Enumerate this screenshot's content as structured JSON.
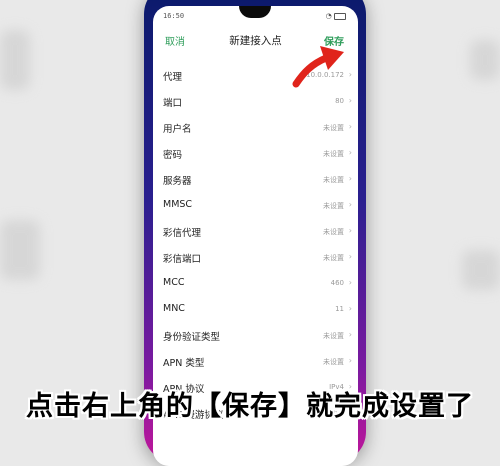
{
  "status": {
    "time": "16:50"
  },
  "nav": {
    "cancel": "取消",
    "title": "新建接入点",
    "save": "保存"
  },
  "fields": [
    {
      "label": "代理",
      "value": "10.0.0.172"
    },
    {
      "label": "端口",
      "value": "80"
    },
    {
      "label": "用户名",
      "value": "未设置"
    },
    {
      "label": "密码",
      "value": "未设置"
    },
    {
      "label": "服务器",
      "value": "未设置"
    },
    {
      "label": "MMSC",
      "value": "未设置"
    },
    {
      "label": "彩信代理",
      "value": "未设置"
    },
    {
      "label": "彩信端口",
      "value": "未设置"
    },
    {
      "label": "MCC",
      "value": "460"
    },
    {
      "label": "MNC",
      "value": "11"
    },
    {
      "label": "身份验证类型",
      "value": "未设置"
    },
    {
      "label": "APN 类型",
      "value": "未设置"
    },
    {
      "label": "APN 协议",
      "value": "IPv4"
    },
    {
      "label": "APN 漫游协议",
      "value": "IPv4"
    }
  ],
  "caption": "点击右上角的【保存】就完成设置了",
  "colors": {
    "accent": "#2e9d5a",
    "arrow": "#e0241b"
  }
}
